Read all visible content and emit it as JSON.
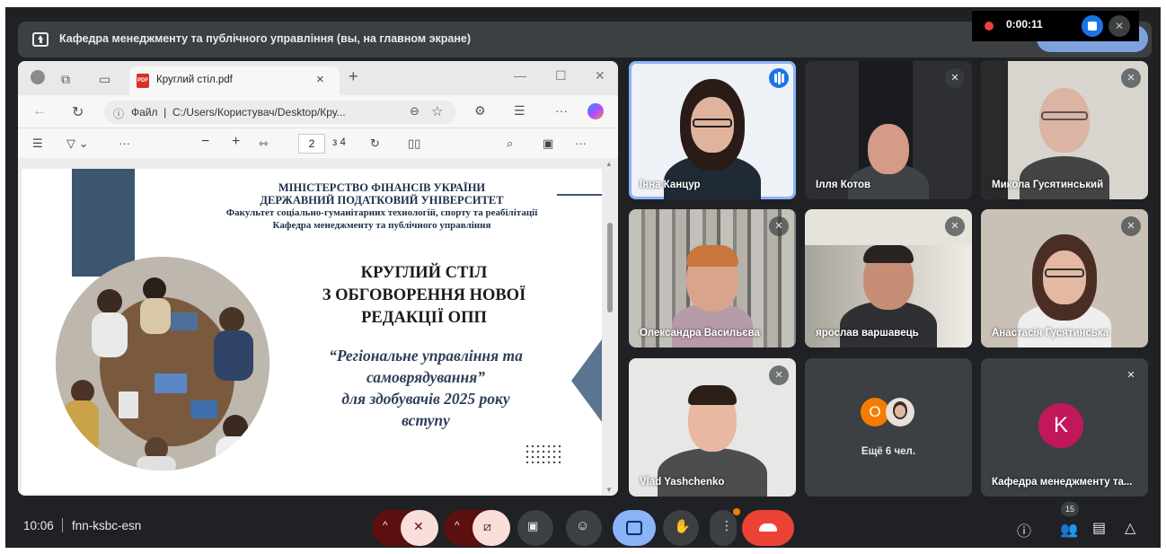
{
  "banner": {
    "text": "Кафедра менеджменту та публічного управління (вы, на главном экране)",
    "icon": "present-icon"
  },
  "recording": {
    "time": "0:00:11"
  },
  "browser": {
    "tab_title": "Круглий стіл.pdf",
    "tab_close": "×",
    "new_tab": "+",
    "url_label": "Файл",
    "url_path": "C:/Users/Користувач/Desktop/Кру...",
    "page_current": "2",
    "page_total": "з 4",
    "more": "···"
  },
  "slide": {
    "ministry": "МІНІСТЕРСТВО ФІНАНСІВ УКРАЇНИ",
    "university": "ДЕРЖАВНИЙ ПОДАТКОВИЙ УНІВЕРСИТЕТ",
    "faculty": "Факультет соціально-гуманітарних технологій, спорту та реабілітації",
    "department": "Кафедра менеджменту та публічного управління",
    "title_line1": "КРУГЛИЙ СТІЛ",
    "title_line2": "З ОБГОВОРЕННЯ НОВОЇ",
    "title_line3": "РЕДАКЦІЇ ОПП",
    "sub_line1": "“Регіональне управління та",
    "sub_line2": "самоврядування”",
    "sub_line3": "для здобувачів 2025 року",
    "sub_line4": "вступу"
  },
  "participants": [
    {
      "name": "Інна Канцур",
      "state": "speaking"
    },
    {
      "name": "Ілля Котов",
      "state": "muted"
    },
    {
      "name": "Микола Гусятинський",
      "state": "muted"
    },
    {
      "name": "Олександра Васильєва",
      "state": "muted"
    },
    {
      "name": "ярослав варшавець",
      "state": "muted"
    },
    {
      "name": "Анастасія Гусятинська",
      "state": "muted"
    },
    {
      "name": "Vlad Yashchenko",
      "state": "muted"
    },
    {
      "name": "Ещё 6 чел.",
      "state": "group",
      "initial": "O"
    },
    {
      "name": "Кафедра менеджменту та...",
      "state": "muted",
      "initial": "K"
    }
  ],
  "bottom": {
    "time": "10:06",
    "meeting_code": "fnn-ksbc-esn",
    "people_count": "15"
  },
  "colors": {
    "background": "#202124",
    "tile": "#3c4043",
    "accent_blue": "#8ab4f8",
    "hangup_red": "#ea4335",
    "mic_off_bg": "#f9dedc",
    "slide_navy": "#3d5670"
  }
}
